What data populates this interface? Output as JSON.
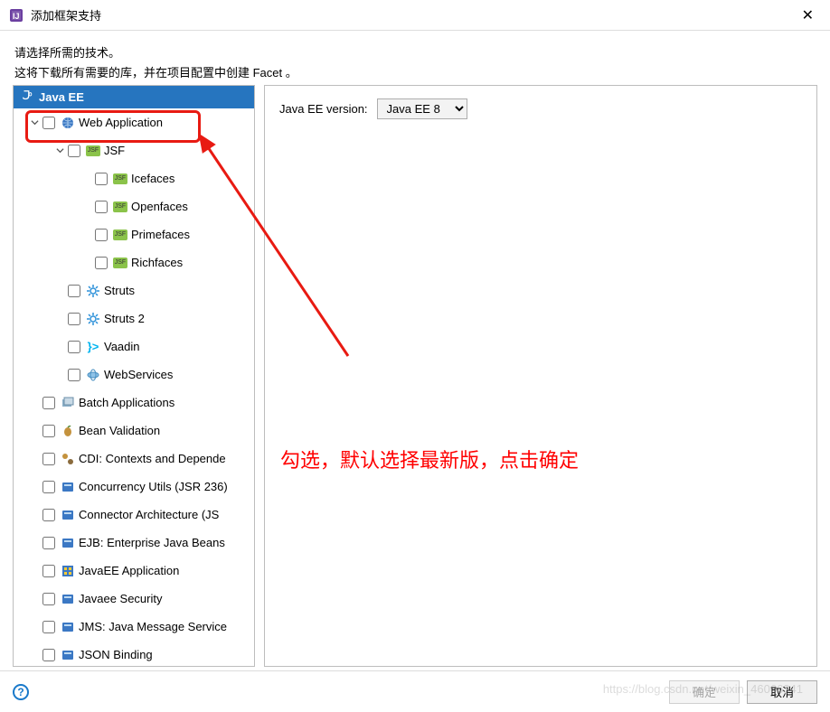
{
  "window": {
    "title": "添加框架支持"
  },
  "intro": {
    "line1": "请选择所需的技术。",
    "line2": "这将下载所有需要的库，并在项目配置中创建 Facet 。"
  },
  "tree": {
    "header": "Java EE",
    "items": [
      {
        "expander": "v",
        "indent": 12,
        "checkbox": true,
        "icon": "web",
        "label": "Web Application"
      },
      {
        "expander": "v",
        "indent": 40,
        "checkbox": true,
        "icon": "jsf",
        "label": "JSF"
      },
      {
        "expander": "",
        "indent": 70,
        "checkbox": true,
        "icon": "jsf",
        "label": "Icefaces"
      },
      {
        "expander": "",
        "indent": 70,
        "checkbox": true,
        "icon": "jsf",
        "label": "Openfaces"
      },
      {
        "expander": "",
        "indent": 70,
        "checkbox": true,
        "icon": "jsf",
        "label": "Primefaces"
      },
      {
        "expander": "",
        "indent": 70,
        "checkbox": true,
        "icon": "jsf",
        "label": "Richfaces"
      },
      {
        "expander": "",
        "indent": 40,
        "checkbox": true,
        "icon": "gear",
        "label": "Struts"
      },
      {
        "expander": "",
        "indent": 40,
        "checkbox": true,
        "icon": "gear",
        "label": "Struts 2"
      },
      {
        "expander": "",
        "indent": 40,
        "checkbox": true,
        "icon": "vaadin",
        "label": "Vaadin"
      },
      {
        "expander": "",
        "indent": 40,
        "checkbox": true,
        "icon": "ws",
        "label": "WebServices"
      },
      {
        "expander": "",
        "indent": 12,
        "checkbox": true,
        "icon": "batch",
        "label": "Batch Applications"
      },
      {
        "expander": "",
        "indent": 12,
        "checkbox": true,
        "icon": "bean",
        "label": "Bean Validation"
      },
      {
        "expander": "",
        "indent": 12,
        "checkbox": true,
        "icon": "cdi",
        "label": "CDI: Contexts and Depende"
      },
      {
        "expander": "",
        "indent": 12,
        "checkbox": true,
        "icon": "blue",
        "label": "Concurrency Utils (JSR 236)"
      },
      {
        "expander": "",
        "indent": 12,
        "checkbox": true,
        "icon": "blue",
        "label": "Connector Architecture (JS"
      },
      {
        "expander": "",
        "indent": 12,
        "checkbox": true,
        "icon": "blue",
        "label": "EJB: Enterprise Java Beans"
      },
      {
        "expander": "",
        "indent": 12,
        "checkbox": true,
        "icon": "javaee",
        "label": "JavaEE Application"
      },
      {
        "expander": "",
        "indent": 12,
        "checkbox": true,
        "icon": "blue",
        "label": "Javaee Security"
      },
      {
        "expander": "",
        "indent": 12,
        "checkbox": true,
        "icon": "blue",
        "label": "JMS: Java Message Service"
      },
      {
        "expander": "",
        "indent": 12,
        "checkbox": true,
        "icon": "blue",
        "label": "JSON Binding"
      }
    ]
  },
  "right": {
    "version_label": "Java EE version:",
    "version_value": "Java EE 8"
  },
  "annotation": {
    "text": "勾选，默认选择最新版，点击确定"
  },
  "footer": {
    "ok": "确定",
    "cancel": "取消"
  },
  "watermark": "https://blog.csdn.net/weixin_46066341"
}
